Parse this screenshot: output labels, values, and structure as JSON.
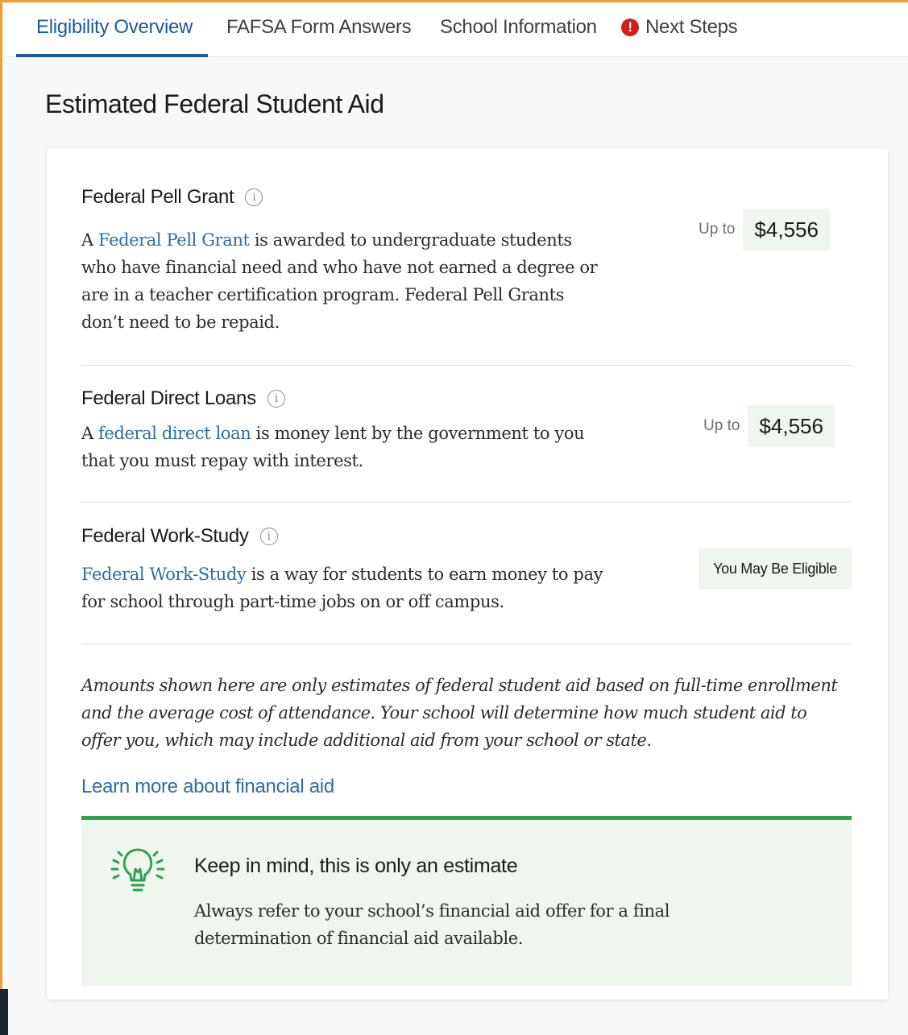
{
  "tabs": {
    "eligibility": "Eligibility Overview",
    "fafsa": "FAFSA Form Answers",
    "school": "School Information",
    "next_steps": "Next Steps",
    "next_steps_alert_icon": "alert-circle-icon"
  },
  "page_title": "Estimated Federal Student Aid",
  "pell": {
    "title": "Federal Pell Grant",
    "info_icon": "info-icon",
    "desc_prefix": "A ",
    "desc_link": "Federal Pell Grant",
    "desc_suffix": " is awarded to undergraduate students who have financial need and who have not earned a degree or are in a teacher certification program. Federal Pell Grants don’t need to be repaid.",
    "up_to": "Up to",
    "amount": "$4,556"
  },
  "loans": {
    "title": "Federal Direct Loans",
    "info_icon": "info-icon",
    "desc_prefix": "A ",
    "desc_link": "federal direct loan",
    "desc_suffix": " is money lent by the government to you that you must repay with interest.",
    "up_to": "Up to",
    "amount": "$4,556"
  },
  "work_study": {
    "title": "Federal Work-Study",
    "info_icon": "info-icon",
    "desc_link": "Federal Work-Study",
    "desc_suffix": " is a way for students to earn money to pay for school through part-time jobs on or off campus.",
    "status": "You May Be Eligible"
  },
  "disclaimer": "Amounts shown here are only estimates of federal student aid based on full-time enrollment and the average cost of attendance. Your school will determine how much student aid to offer you, which may include additional aid from your school or state.",
  "learn_more": "Learn more about financial aid",
  "callout": {
    "icon": "lightbulb-icon",
    "title": "Keep in mind, this is only an estimate",
    "text": "Always refer to your school’s financial aid offer for a final determination of financial aid available."
  },
  "colors": {
    "accent": "#1a5b9a",
    "link": "#2e6da4",
    "success": "#2fa34a",
    "success_bg": "#eef6ee",
    "alert": "#d31c1c",
    "frame": "#f0a030"
  }
}
